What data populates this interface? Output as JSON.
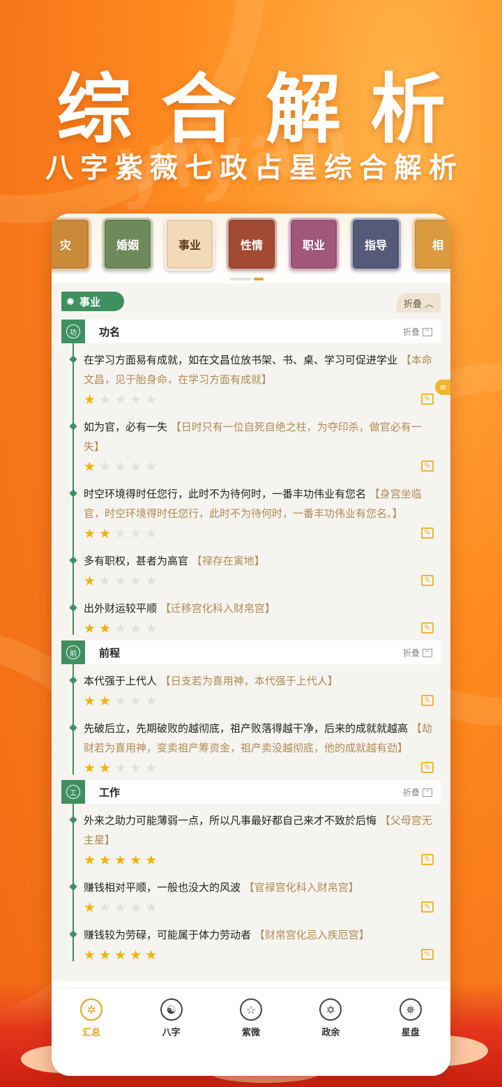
{
  "hero": {
    "watermark": "yiyan",
    "title": "综合解析",
    "subtitle": "八字紫薇七政占星综合解析"
  },
  "categories": [
    {
      "label": "灾",
      "color": "#c98a3a"
    },
    {
      "label": "婚姻",
      "color": "#6f8a5a"
    },
    {
      "label": "事业",
      "color": "#f2d9b8"
    },
    {
      "label": "性情",
      "color": "#a24a32"
    },
    {
      "label": "职业",
      "color": "#a0577a"
    },
    {
      "label": "指导",
      "color": "#545a78"
    },
    {
      "label": "相",
      "color": "#d99a40"
    }
  ],
  "section": {
    "tag": "事业",
    "fold_label": "折叠",
    "fold_icon": "chevron-up-icon"
  },
  "side_tab_icon": "menu-icon",
  "groups": [
    {
      "badge": "功",
      "title": "功名",
      "fold_label": "折叠",
      "items": [
        {
          "text": "在学习方面易有成就，如在文昌位放书架、书、桌、学习可促进学业",
          "note": "【本命文昌，见于胎身命，在学习方面有成就】",
          "rating": 1
        },
        {
          "text": "如为官，必有一失",
          "note": "【日时只有一位自死自绝之柱，为夺印杀，做官必有一失】",
          "rating": 1
        },
        {
          "text": "时空环境得时任您行，此时不为待何时，一番丰功伟业有您名",
          "note": "【身宫坐临官，时空环境得时任您行，此时不为待何时，一番丰功伟业有您名。】",
          "rating": 2
        },
        {
          "text": "多有职权，甚者为高官",
          "note": "【禄存在寅地】",
          "rating": 1
        },
        {
          "text": "出外财运较平顺",
          "note": "【迁移宫化科入财帛宫】",
          "rating": 2
        }
      ]
    },
    {
      "badge": "前",
      "title": "前程",
      "fold_label": "折叠",
      "items": [
        {
          "text": "本代强于上代人",
          "note": "【日支若为喜用神，本代强于上代人】",
          "rating": 2
        },
        {
          "text": "先破后立，先期破败的越彻底，祖产败落得越干净，后来的成就就越高",
          "note": "【劫财若为喜用神，变卖祖产筹资金，祖产卖没越彻底，他的成就越有劲】",
          "rating": 2
        }
      ]
    },
    {
      "badge": "工",
      "title": "工作",
      "fold_label": "折叠",
      "items": [
        {
          "text": "外来之助力可能薄弱一点，所以凡事最好都自己来才不致於后悔",
          "note": "【父母宫无主星】",
          "rating": 5
        },
        {
          "text": "赚钱相对平顺，一般也没大的风波",
          "note": "【官禄宫化科入财帛宫】",
          "rating": 1
        },
        {
          "text": "赚钱较为劳碌，可能属于体力劳动者",
          "note": "【财帛宫化忌入疾厄宫】",
          "rating": 5
        }
      ]
    }
  ],
  "tabbar": [
    {
      "label": "汇总",
      "icon": "summary-icon",
      "glyph": "✲",
      "active": true
    },
    {
      "label": "八字",
      "icon": "taiji-icon",
      "glyph": "☯",
      "active": false
    },
    {
      "label": "紫微",
      "icon": "star-icon",
      "glyph": "☆",
      "active": false
    },
    {
      "label": "政余",
      "icon": "hexagram-icon",
      "glyph": "✡",
      "active": false
    },
    {
      "label": "星盘",
      "icon": "compass-icon",
      "glyph": "✵",
      "active": false
    }
  ],
  "colors": {
    "accent_green": "#3f8f5f",
    "accent_gold": "#f4b30b",
    "note_brown": "#b08a52",
    "background_orange": "#f6761a"
  }
}
